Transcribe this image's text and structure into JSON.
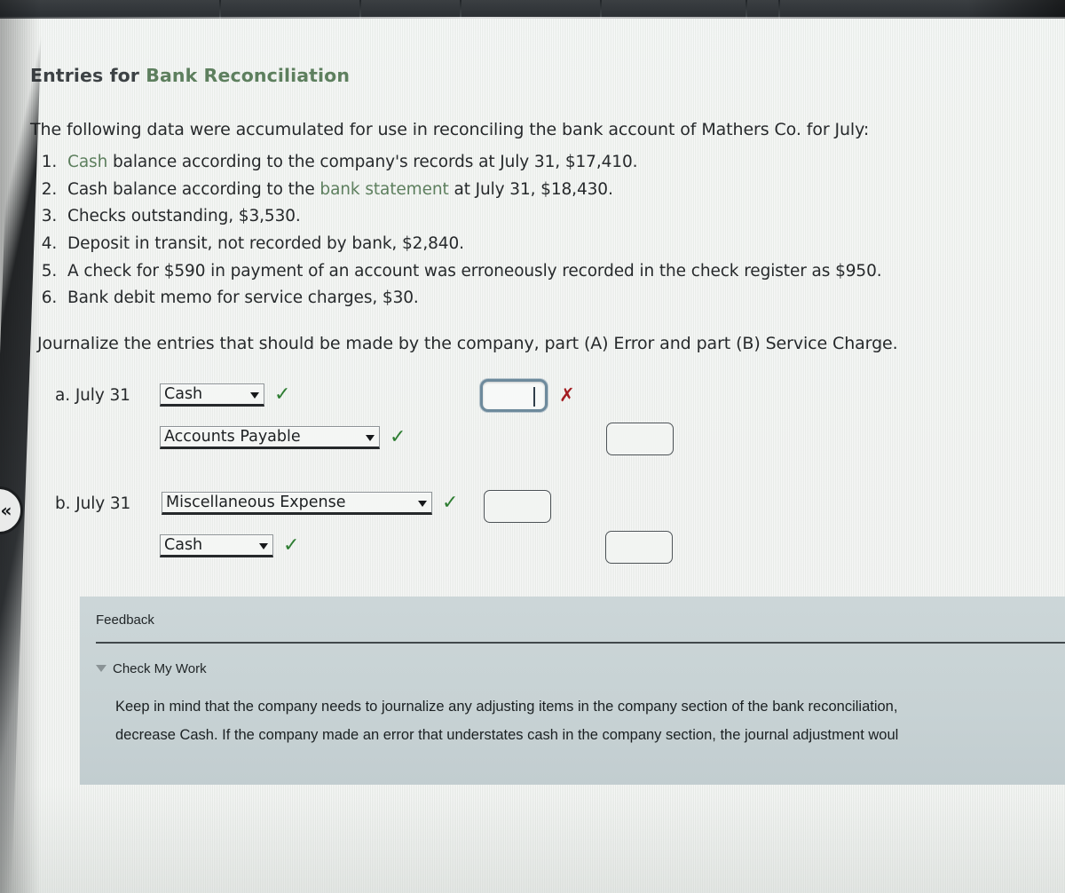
{
  "browser": {
    "tab_strip_label": "browser-tabs"
  },
  "nav": {
    "prev_icon": "chevron-left-icon",
    "prev_glyph": "«"
  },
  "header": {
    "title_prefix": "Entries for ",
    "title_link": "Bank Reconciliation"
  },
  "intro": "The following data were accumulated for use in reconciling the bank account of Mathers Co. for July:",
  "facts": [
    {
      "link": "Cash",
      "rest": " balance according to the company's records at July 31, $17,410."
    },
    {
      "pre": "Cash balance according to the ",
      "link": "bank statement",
      "rest": " at July 31, $18,430."
    },
    {
      "plain": "Checks outstanding, $3,530."
    },
    {
      "plain": "Deposit in transit, not recorded by bank, $2,840."
    },
    {
      "plain": "A check for $590 in payment of an account was erroneously recorded in the check register as $950."
    },
    {
      "plain": "Bank debit memo for service charges, $30."
    }
  ],
  "journalize_instruction": "Journalize the entries that should be made by the company, part (A) Error and part (B) Service Charge.",
  "journal": {
    "entries": [
      {
        "letter": "a.",
        "date": "July 31",
        "lines": [
          {
            "account": "Cash",
            "status": "correct",
            "status_glyph": "✓",
            "debit_value": "",
            "credit_value": "",
            "debit_state": "focused",
            "debit_mark": "incorrect",
            "debit_mark_glyph": "✗"
          },
          {
            "account": "Accounts Payable",
            "status": "correct",
            "status_glyph": "✓",
            "debit_value": "",
            "credit_value": ""
          }
        ]
      },
      {
        "letter": "b.",
        "date": "July 31",
        "lines": [
          {
            "account": "Miscellaneous Expense",
            "status": "correct",
            "status_glyph": "✓",
            "debit_value": "",
            "credit_value": ""
          },
          {
            "account": "Cash",
            "status": "correct",
            "status_glyph": "✓",
            "debit_value": "",
            "credit_value": ""
          }
        ]
      }
    ]
  },
  "feedback": {
    "title": "Feedback",
    "check_my_work": "Check My Work",
    "toggle_icon": "triangle-down-icon",
    "body_line_1": "Keep in mind that the company needs to journalize any adjusting items in the company section of the bank reconciliation,",
    "body_line_2": "decrease Cash. If the company made an error that understates cash in the company section, the journal adjustment woul"
  },
  "colors": {
    "page_background": "#eef1ef",
    "glossary_link": "#5d7f5e",
    "correct_mark": "#2e7d32",
    "incorrect_mark": "#a31c20",
    "feedback_panel": "#c9d4d6",
    "focus_ring": "#6d8a9c",
    "body_text": "#26292b"
  }
}
